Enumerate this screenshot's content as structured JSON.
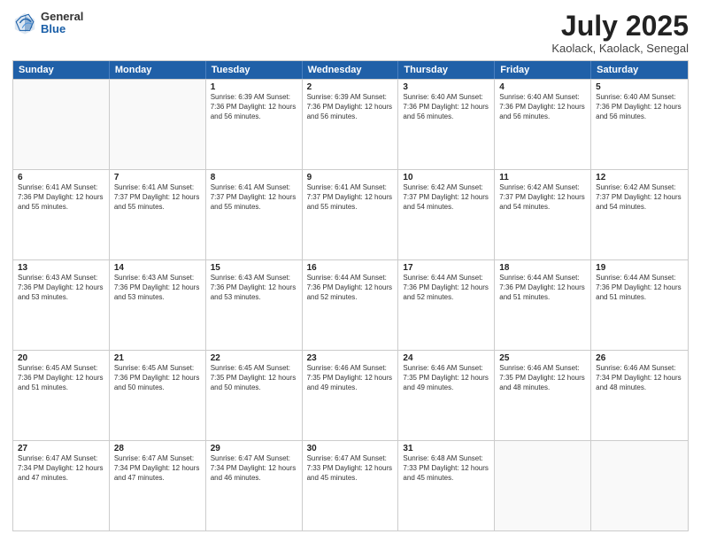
{
  "logo": {
    "general": "General",
    "blue": "Blue"
  },
  "header": {
    "month": "July 2025",
    "location": "Kaolack, Kaolack, Senegal"
  },
  "days_of_week": [
    "Sunday",
    "Monday",
    "Tuesday",
    "Wednesday",
    "Thursday",
    "Friday",
    "Saturday"
  ],
  "rows": [
    [
      {
        "day": "",
        "detail": ""
      },
      {
        "day": "",
        "detail": ""
      },
      {
        "day": "1",
        "detail": "Sunrise: 6:39 AM\nSunset: 7:36 PM\nDaylight: 12 hours and 56 minutes."
      },
      {
        "day": "2",
        "detail": "Sunrise: 6:39 AM\nSunset: 7:36 PM\nDaylight: 12 hours and 56 minutes."
      },
      {
        "day": "3",
        "detail": "Sunrise: 6:40 AM\nSunset: 7:36 PM\nDaylight: 12 hours and 56 minutes."
      },
      {
        "day": "4",
        "detail": "Sunrise: 6:40 AM\nSunset: 7:36 PM\nDaylight: 12 hours and 56 minutes."
      },
      {
        "day": "5",
        "detail": "Sunrise: 6:40 AM\nSunset: 7:36 PM\nDaylight: 12 hours and 56 minutes."
      }
    ],
    [
      {
        "day": "6",
        "detail": "Sunrise: 6:41 AM\nSunset: 7:36 PM\nDaylight: 12 hours and 55 minutes."
      },
      {
        "day": "7",
        "detail": "Sunrise: 6:41 AM\nSunset: 7:37 PM\nDaylight: 12 hours and 55 minutes."
      },
      {
        "day": "8",
        "detail": "Sunrise: 6:41 AM\nSunset: 7:37 PM\nDaylight: 12 hours and 55 minutes."
      },
      {
        "day": "9",
        "detail": "Sunrise: 6:41 AM\nSunset: 7:37 PM\nDaylight: 12 hours and 55 minutes."
      },
      {
        "day": "10",
        "detail": "Sunrise: 6:42 AM\nSunset: 7:37 PM\nDaylight: 12 hours and 54 minutes."
      },
      {
        "day": "11",
        "detail": "Sunrise: 6:42 AM\nSunset: 7:37 PM\nDaylight: 12 hours and 54 minutes."
      },
      {
        "day": "12",
        "detail": "Sunrise: 6:42 AM\nSunset: 7:37 PM\nDaylight: 12 hours and 54 minutes."
      }
    ],
    [
      {
        "day": "13",
        "detail": "Sunrise: 6:43 AM\nSunset: 7:36 PM\nDaylight: 12 hours and 53 minutes."
      },
      {
        "day": "14",
        "detail": "Sunrise: 6:43 AM\nSunset: 7:36 PM\nDaylight: 12 hours and 53 minutes."
      },
      {
        "day": "15",
        "detail": "Sunrise: 6:43 AM\nSunset: 7:36 PM\nDaylight: 12 hours and 53 minutes."
      },
      {
        "day": "16",
        "detail": "Sunrise: 6:44 AM\nSunset: 7:36 PM\nDaylight: 12 hours and 52 minutes."
      },
      {
        "day": "17",
        "detail": "Sunrise: 6:44 AM\nSunset: 7:36 PM\nDaylight: 12 hours and 52 minutes."
      },
      {
        "day": "18",
        "detail": "Sunrise: 6:44 AM\nSunset: 7:36 PM\nDaylight: 12 hours and 51 minutes."
      },
      {
        "day": "19",
        "detail": "Sunrise: 6:44 AM\nSunset: 7:36 PM\nDaylight: 12 hours and 51 minutes."
      }
    ],
    [
      {
        "day": "20",
        "detail": "Sunrise: 6:45 AM\nSunset: 7:36 PM\nDaylight: 12 hours and 51 minutes."
      },
      {
        "day": "21",
        "detail": "Sunrise: 6:45 AM\nSunset: 7:36 PM\nDaylight: 12 hours and 50 minutes."
      },
      {
        "day": "22",
        "detail": "Sunrise: 6:45 AM\nSunset: 7:35 PM\nDaylight: 12 hours and 50 minutes."
      },
      {
        "day": "23",
        "detail": "Sunrise: 6:46 AM\nSunset: 7:35 PM\nDaylight: 12 hours and 49 minutes."
      },
      {
        "day": "24",
        "detail": "Sunrise: 6:46 AM\nSunset: 7:35 PM\nDaylight: 12 hours and 49 minutes."
      },
      {
        "day": "25",
        "detail": "Sunrise: 6:46 AM\nSunset: 7:35 PM\nDaylight: 12 hours and 48 minutes."
      },
      {
        "day": "26",
        "detail": "Sunrise: 6:46 AM\nSunset: 7:34 PM\nDaylight: 12 hours and 48 minutes."
      }
    ],
    [
      {
        "day": "27",
        "detail": "Sunrise: 6:47 AM\nSunset: 7:34 PM\nDaylight: 12 hours and 47 minutes."
      },
      {
        "day": "28",
        "detail": "Sunrise: 6:47 AM\nSunset: 7:34 PM\nDaylight: 12 hours and 47 minutes."
      },
      {
        "day": "29",
        "detail": "Sunrise: 6:47 AM\nSunset: 7:34 PM\nDaylight: 12 hours and 46 minutes."
      },
      {
        "day": "30",
        "detail": "Sunrise: 6:47 AM\nSunset: 7:33 PM\nDaylight: 12 hours and 45 minutes."
      },
      {
        "day": "31",
        "detail": "Sunrise: 6:48 AM\nSunset: 7:33 PM\nDaylight: 12 hours and 45 minutes."
      },
      {
        "day": "",
        "detail": ""
      },
      {
        "day": "",
        "detail": ""
      }
    ]
  ]
}
